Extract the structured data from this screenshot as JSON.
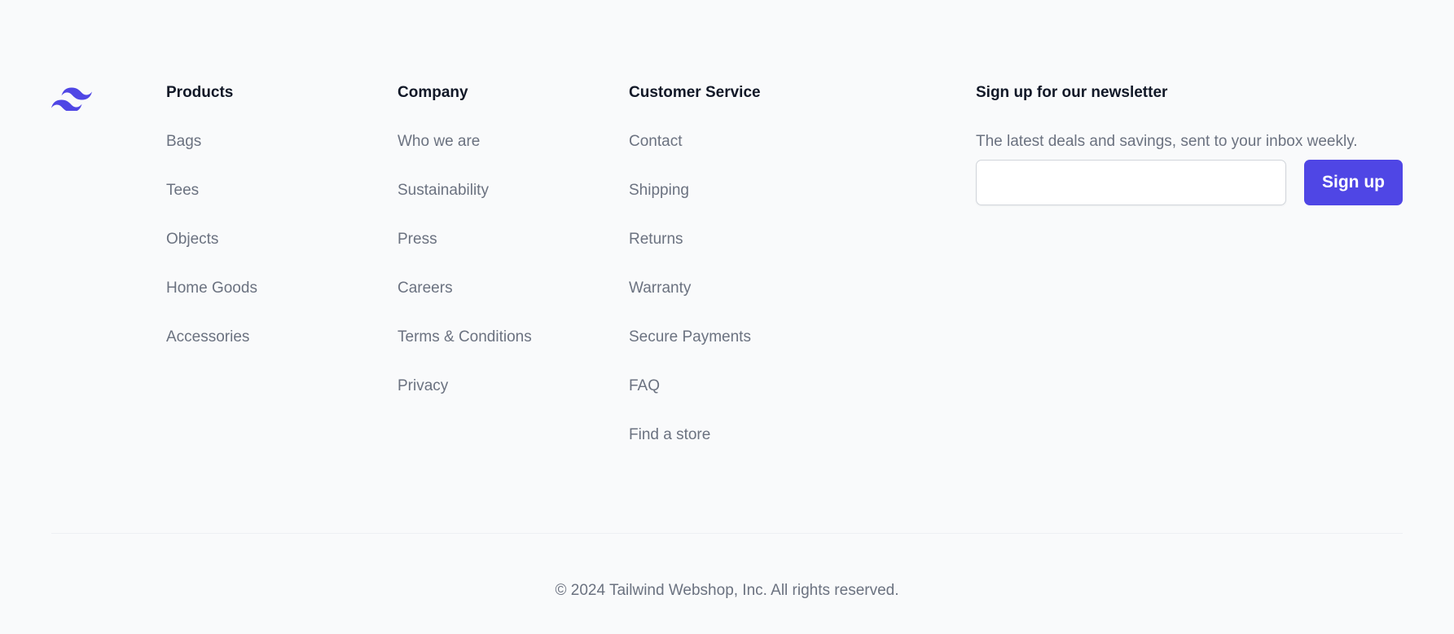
{
  "brand": {
    "logo_icon": "tailwind-waves-icon",
    "accent_color": "#4f46e5"
  },
  "columns": {
    "products": {
      "heading": "Products",
      "items": [
        "Bags",
        "Tees",
        "Objects",
        "Home Goods",
        "Accessories"
      ]
    },
    "company": {
      "heading": "Company",
      "items": [
        "Who we are",
        "Sustainability",
        "Press",
        "Careers",
        "Terms & Conditions",
        "Privacy"
      ]
    },
    "customer_service": {
      "heading": "Customer Service",
      "items": [
        "Contact",
        "Shipping",
        "Returns",
        "Warranty",
        "Secure Payments",
        "FAQ",
        "Find a store"
      ]
    }
  },
  "newsletter": {
    "heading": "Sign up for our newsletter",
    "description": "The latest deals and savings, sent to your inbox weekly.",
    "email_value": "",
    "button_label": "Sign up"
  },
  "copyright": "© 2024 Tailwind Webshop, Inc. All rights reserved."
}
